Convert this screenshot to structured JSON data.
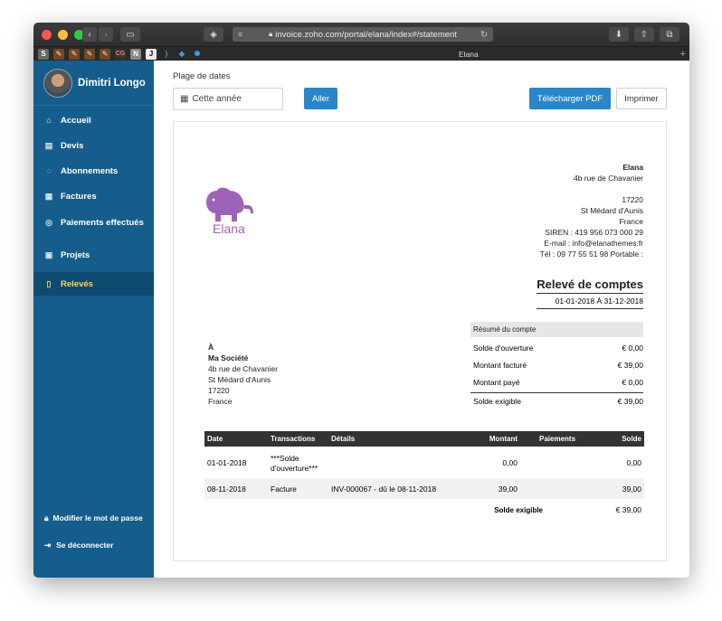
{
  "browser": {
    "url": "invoice.zoho.com/portal/elana/index#/statement",
    "tab_title": "Elana",
    "colors": {
      "chrome": "#2e2e30",
      "close": "#fc5753",
      "minimize": "#fdbc40",
      "maximize": "#33c748"
    }
  },
  "sidebar": {
    "user_name": "Dimitri Longo",
    "items": [
      {
        "label": "Accueil",
        "icon": "home-icon"
      },
      {
        "label": "Devis",
        "icon": "document-icon"
      },
      {
        "label": "Abonnements",
        "icon": "subscription-icon"
      },
      {
        "label": "Factures",
        "icon": "invoice-icon"
      },
      {
        "label": "Paiements effectués",
        "icon": "payment-icon"
      },
      {
        "label": "Projets",
        "icon": "briefcase-icon"
      },
      {
        "label": "Relevés",
        "icon": "statement-icon"
      }
    ],
    "change_password": "Modifier le mot de passe",
    "logout": "Se déconnecter",
    "colors": {
      "background": "#155d8c",
      "active": "#0f4a71",
      "active_text": "#f3d46a"
    }
  },
  "toolbar": {
    "range_label": "Plage de dates",
    "range_value": "Cette année",
    "go_button": "Aller",
    "download_button": "Télécharger PDF",
    "print_button": "Imprimer"
  },
  "statement": {
    "logo_text": "Elana",
    "company_lines": [
      "Elana",
      "4b rue de Chavanier",
      "",
      "17220",
      "St Médard d'Aunis",
      "France",
      "SIREN : 419 956 073 000 29",
      "E-mail : info@elanathemes.fr",
      "Tél : 09 77 55 51 98 Portable :"
    ],
    "title": "Relevé de comptes",
    "date_range": "01-01-2018 À 31-12-2018",
    "to_lines": [
      "À",
      "Ma Société",
      "4b rue de Chavanier",
      "St Médard d'Aunis",
      "17220",
      "France"
    ],
    "summary": {
      "header": "Résumé du compte",
      "rows": [
        {
          "label": "Solde d'ouverture",
          "value": "€ 0,00"
        },
        {
          "label": "Montant facturé",
          "value": "€ 39,00"
        },
        {
          "label": "Montant payé",
          "value": "€ 0,00"
        },
        {
          "label": "Solde exigible",
          "value": "€ 39,00"
        }
      ]
    },
    "table": {
      "headers": [
        "Date",
        "Transactions",
        "Détails",
        "Montant",
        "Paiements",
        "Solde"
      ],
      "rows": [
        [
          "01-01-2018",
          "***Solde d'ouverture***",
          "",
          "0,00",
          "",
          "0,00"
        ],
        [
          "08-11-2018",
          "Facture",
          "INV-000067 - dû le 08-11-2018",
          "39,00",
          "",
          "39,00"
        ]
      ],
      "footer_label": "Solde exigible",
      "footer_value": "€ 39,00"
    },
    "colors": {
      "logo": "#9d63b8",
      "table_header": "#333333",
      "button": "#2a86c8"
    }
  }
}
